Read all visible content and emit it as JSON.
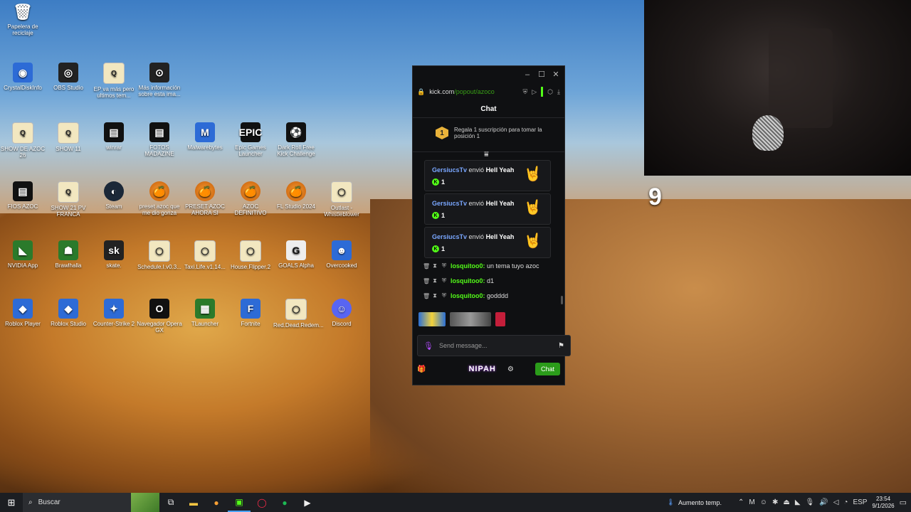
{
  "desktop": {
    "icons": [
      {
        "label": "Papelera de reciclaje",
        "icon": "recycle-bin-icon",
        "glyph": "🗑"
      },
      {
        "label": "CrystalDiskInfo",
        "icon": "crystaldiskinfo-icon",
        "glyph": "◉"
      },
      {
        "label": "OBS Studio",
        "icon": "obs-icon",
        "glyph": "◎"
      },
      {
        "label": "EP va más pero ultimos tem...",
        "icon": "file-icon",
        "glyph": "Q"
      },
      {
        "label": "Más información sobre esta ima...",
        "icon": "info-camera-icon",
        "glyph": "⊙"
      },
      {
        "label": "SHOW DE AZOC 26",
        "icon": "file-icon",
        "glyph": "Q"
      },
      {
        "label": "SHOW 11",
        "icon": "file-icon",
        "glyph": "Q"
      },
      {
        "label": "winrar",
        "icon": "winrar-icon",
        "glyph": "▤"
      },
      {
        "label": "FOTOS MADAZINE",
        "icon": "winrar-icon",
        "glyph": "▤"
      },
      {
        "label": "Malwarebytes",
        "icon": "malwarebytes-icon",
        "glyph": "M"
      },
      {
        "label": "Epic Games Launcher",
        "icon": "epic-games-icon",
        "glyph": "EPIC"
      },
      {
        "label": "Dark Roll Free Kick Challenge",
        "icon": "football-icon",
        "glyph": "⚽"
      },
      {
        "label": "FIOS AZOC",
        "icon": "winrar-icon",
        "glyph": "▤"
      },
      {
        "label": "SHOW 21 PV FRANCA",
        "icon": "file-icon",
        "glyph": "Q"
      },
      {
        "label": "Steam",
        "icon": "steam-icon",
        "glyph": "◐"
      },
      {
        "label": "preset azoc que me dio gonza",
        "icon": "fl-studio-icon",
        "glyph": "🍊"
      },
      {
        "label": "PRESET AZOC AHORA SI",
        "icon": "fl-studio-icon",
        "glyph": "🍊"
      },
      {
        "label": "AZOC DEFINITIVO",
        "icon": "fl-studio-icon",
        "glyph": "🍊"
      },
      {
        "label": "FL Studio 2024",
        "icon": "fl-studio-icon",
        "glyph": "🍊"
      },
      {
        "label": "Outlast - Whistleblower",
        "icon": "file-icon",
        "glyph": "◯"
      },
      {
        "label": "NVIDIA App",
        "icon": "nvidia-icon",
        "glyph": "◣"
      },
      {
        "label": "Brawlhalla",
        "icon": "brawlhalla-icon",
        "glyph": "☗"
      },
      {
        "label": "skate.",
        "icon": "skate-icon",
        "glyph": "sk"
      },
      {
        "label": "Schedule.I.v0.3...",
        "icon": "file-icon",
        "glyph": "◯"
      },
      {
        "label": "Taxi.Life.v1.14...",
        "icon": "file-icon",
        "glyph": "◯"
      },
      {
        "label": "House.Flipper.2",
        "icon": "file-icon",
        "glyph": "◯"
      },
      {
        "label": "GOALS Alpha",
        "icon": "goals-icon",
        "glyph": "G"
      },
      {
        "label": "Overcooked",
        "icon": "overcooked-icon",
        "glyph": "☻"
      },
      {
        "label": "Roblox Player",
        "icon": "roblox-icon",
        "glyph": "◆"
      },
      {
        "label": "Roblox Studio",
        "icon": "roblox-studio-icon",
        "glyph": "◆"
      },
      {
        "label": "Counter-Strike 2",
        "icon": "counter-strike-icon",
        "glyph": "✦"
      },
      {
        "label": "Navegador Opera GX",
        "icon": "opera-gx-icon",
        "glyph": "O"
      },
      {
        "label": "TLauncher",
        "icon": "minecraft-icon",
        "glyph": "▦"
      },
      {
        "label": "Fortnite",
        "icon": "fortnite-icon",
        "glyph": "F"
      },
      {
        "label": "Red.Dead.Redem...",
        "icon": "file-icon",
        "glyph": "◯"
      },
      {
        "label": "Discord",
        "icon": "discord-icon",
        "glyph": "☺"
      }
    ]
  },
  "kick": {
    "url_host": "kick.com",
    "url_path": "/popout/azoco",
    "chat_title": "Chat",
    "gift_text": "Regala 1 suscripción para tomar la posición 1",
    "gift_rank": "1",
    "cards": [
      {
        "user": "GersiucsTv",
        "verb": " envió ",
        "item": "Hell Yeah",
        "count": "1",
        "emoji": "🤘"
      },
      {
        "user": "GersiucsTv",
        "verb": " envió ",
        "item": "Hell Yeah",
        "count": "1",
        "emoji": "🤘"
      },
      {
        "user": "GersiucsTv",
        "verb": " envió ",
        "item": "Hell Yeah",
        "count": "1",
        "emoji": "🤘"
      }
    ],
    "messages": [
      {
        "name": "losquitoo0:",
        "text": " un tema tuyo azoc"
      },
      {
        "name": "losquitoo0:",
        "text": " d1"
      },
      {
        "name": "losquitoo0:",
        "text": " godddd"
      }
    ],
    "input_placeholder": "Send message...",
    "nipah_label": "NIPAH",
    "chat_button": "Chat"
  },
  "overlay": {
    "counter": "9"
  },
  "taskbar": {
    "search_placeholder": "Buscar",
    "weather_text": "Aumento temp.",
    "language": "ESP",
    "time": "23:54",
    "date": "9/1/2026"
  },
  "colors": {
    "kick_green": "#53fc18",
    "chat_button": "#2b9c1a",
    "username_blue": "#7aa7ff"
  }
}
